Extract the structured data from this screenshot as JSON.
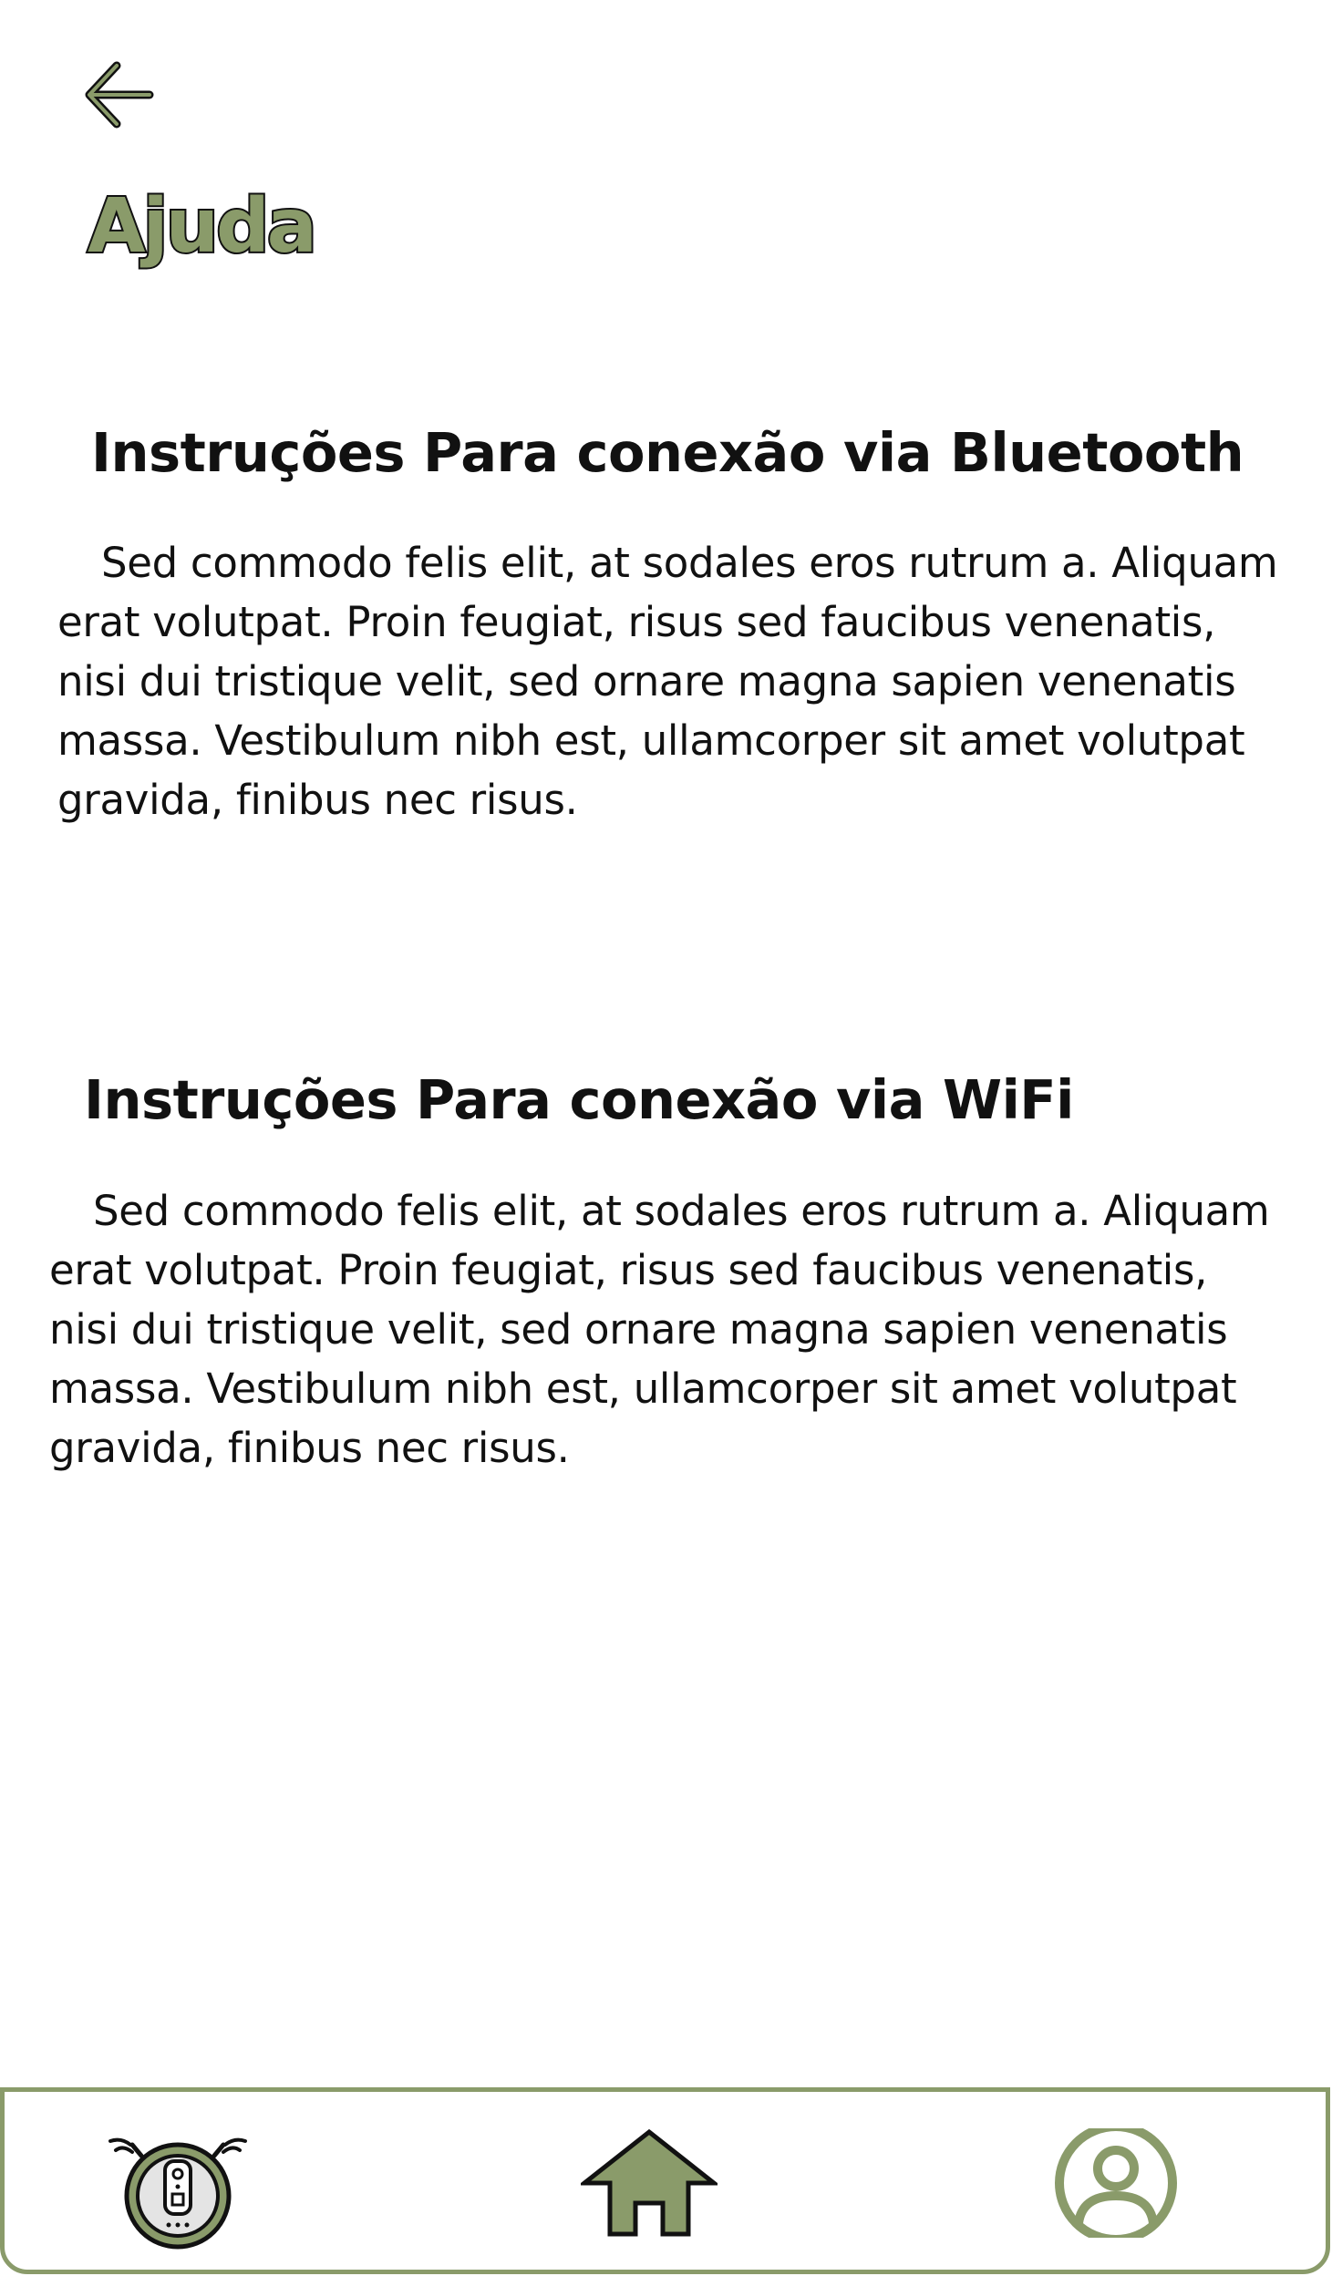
{
  "header": {
    "back_icon": "arrow-left-icon",
    "title": "Ajuda"
  },
  "sections": [
    {
      "heading": "Instruções Para conexão via Bluetooth",
      "body": "Sed commodo felis elit, at sodales eros rutrum a. Aliquam erat volutpat. Proin feugiat, risus sed faucibus venenatis, nisi dui tristique velit, sed ornare magna sapien venenatis massa. Vestibulum nibh est, ullamcorper sit amet volutpat gravida, finibus nec risus."
    },
    {
      "heading": "Instruções Para conexão via WiFi",
      "body": "Sed commodo felis elit, at sodales eros rutrum a. Aliquam erat volutpat. Proin feugiat, risus sed faucibus venenatis, nisi dui tristique velit, sed ornare magna sapien venenatis massa. Vestibulum nibh est, ullamcorper sit amet volutpat gravida, finibus nec risus."
    }
  ],
  "bottom_nav": {
    "items": [
      {
        "icon": "robot-vacuum-icon"
      },
      {
        "icon": "home-icon"
      },
      {
        "icon": "user-profile-icon"
      }
    ]
  },
  "colors": {
    "accent": "#8a9b6a",
    "text": "#111111",
    "background": "#ffffff"
  }
}
